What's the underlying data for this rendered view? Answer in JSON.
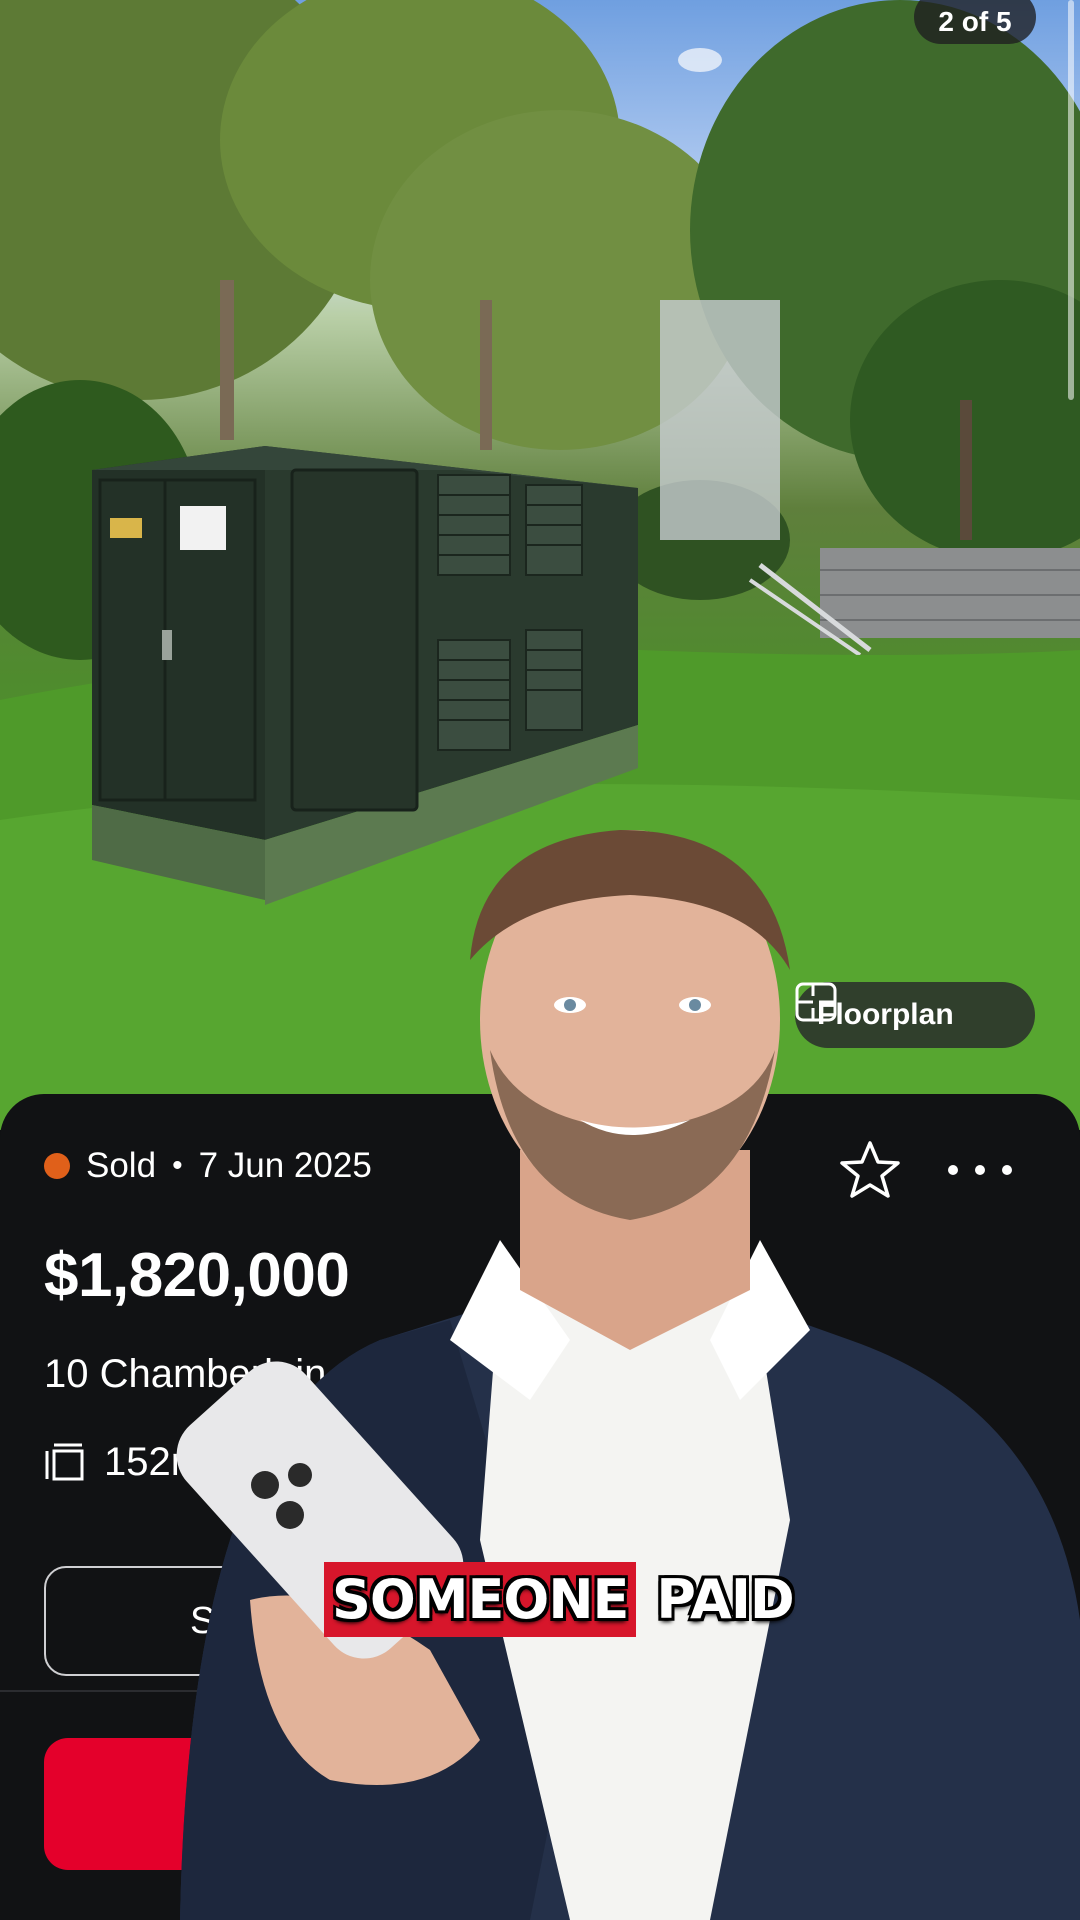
{
  "gallery": {
    "counter": "2 of 5"
  },
  "floorplan": {
    "label": "Floorplan",
    "icon": "floorplan-icon"
  },
  "listing": {
    "status": "Sold",
    "status_color": "#e0601a",
    "separator": "•",
    "date": "7 Jun 2025",
    "price": "$1,820,000",
    "address": "10 Chamberlain",
    "land_size": "152m²",
    "button_partial": "S"
  },
  "caption": {
    "word1": "SOMEONE",
    "word2": "PAID"
  },
  "colors": {
    "accent_red": "#e4002b",
    "card_bg": "#111214",
    "caption_highlight": "#d7162b"
  }
}
